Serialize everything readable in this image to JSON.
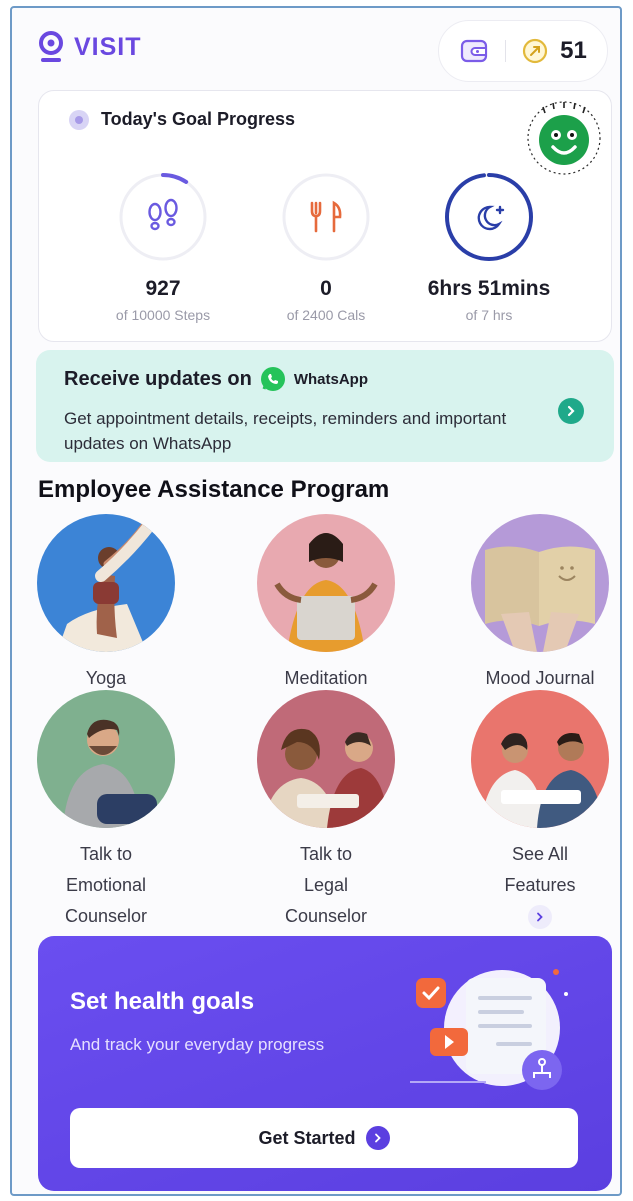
{
  "header": {
    "brand": "VISIT",
    "coins": "51"
  },
  "goals": {
    "title": "Today's Goal Progress",
    "metrics": [
      {
        "value": "927",
        "target": "of 10000 Steps",
        "icon": "footsteps-icon",
        "progress": 0.0927
      },
      {
        "value": "0",
        "target": "of 2400 Cals",
        "icon": "fork-knife-icon",
        "progress": 0
      },
      {
        "value": "6hrs 51mins",
        "target": "of 7 hrs",
        "icon": "moon-stars-icon",
        "progress": 0.979
      }
    ]
  },
  "whatsapp": {
    "title": "Receive updates on",
    "brand": "WhatsApp",
    "description": "Get appointment details, receipts, reminders and important updates on WhatsApp"
  },
  "eap": {
    "title": "Employee Assistance Program",
    "tiles": [
      {
        "label": "Yoga"
      },
      {
        "label": "Meditation"
      },
      {
        "label": "Mood Journal"
      },
      {
        "label_lines": [
          "Talk to",
          "Emotional",
          "Counselor"
        ]
      },
      {
        "label_lines": [
          "Talk to",
          "Legal",
          "Counselor"
        ]
      },
      {
        "label_lines": [
          "See All",
          "Features"
        ]
      }
    ]
  },
  "health": {
    "title": "Set health goals",
    "subtitle": "And track your everyday progress",
    "cta": "Get Started"
  },
  "colors": {
    "brand": "#6a48e0",
    "whatsapp_bg": "#d8f3ee",
    "steps_ring": "#6a5ae0",
    "sleep_ring": "#2a3ea8",
    "cals_icon": "#e66a3c"
  }
}
